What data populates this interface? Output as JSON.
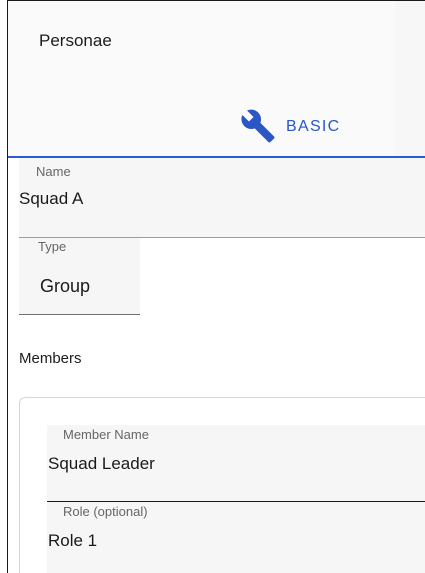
{
  "header": {
    "title": "Personae"
  },
  "tabs": {
    "active": {
      "label": "BASIC",
      "icon": "wrench-icon",
      "color": "#2a56c6"
    }
  },
  "form": {
    "name": {
      "label": "Name",
      "value": "Squad A"
    },
    "type": {
      "label": "Type",
      "value": "Group"
    }
  },
  "members": {
    "title": "Members",
    "items": [
      {
        "member_name_label": "Member Name",
        "member_name_value": "Squad Leader",
        "role_label": "Role (optional)",
        "role_value": "Role 1"
      }
    ]
  }
}
